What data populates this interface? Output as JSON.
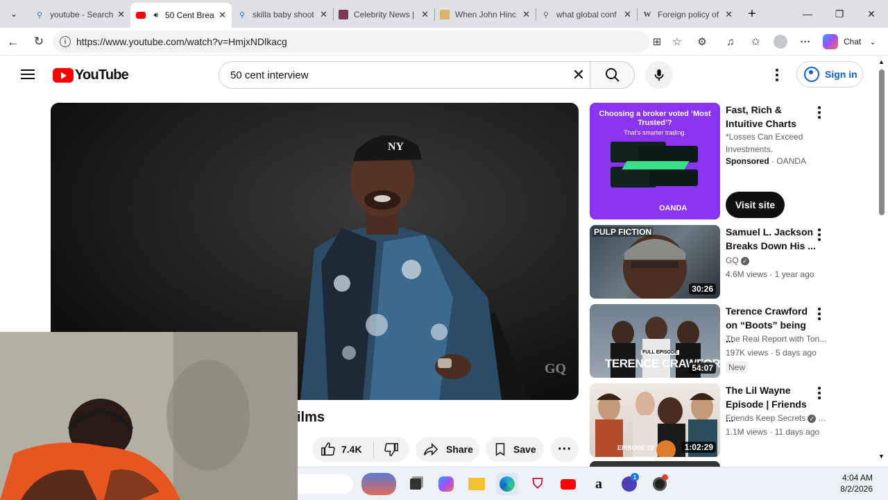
{
  "browser": {
    "tabs": [
      {
        "title": "youtube - Search",
        "icon": "search-icon"
      },
      {
        "title": "50 Cent Brea",
        "icon": "youtube-icon",
        "active": true
      },
      {
        "title": "skilla baby shoot",
        "icon": "search-icon"
      },
      {
        "title": "Celebrity News |",
        "icon": "site-favicon"
      },
      {
        "title": "When John Hinc",
        "icon": "site-favicon"
      },
      {
        "title": "what global conf",
        "icon": "search-icon"
      },
      {
        "title": "Foreign policy of",
        "icon": "wikipedia-icon"
      }
    ],
    "url": "https://www.youtube.com/watch?v=HmjxNDlkacg",
    "chat_label": "Chat"
  },
  "youtube": {
    "logo_text": "YouTube",
    "search_value": "50 cent interview",
    "signin_label": "Sign in"
  },
  "video": {
    "watermark": "GQ",
    "title_fragment": "ilms",
    "like_count": "7.4K",
    "share_label": "Share",
    "save_label": "Save"
  },
  "sidebar": {
    "ad": {
      "headline": "Choosing a broker voted ‘Most Trusted’?",
      "sub": "That’s smarter trading.",
      "brand_mark": "OANDA",
      "title": "Fast, Rich & Intuitive Charts",
      "desc": "*Losses Can Exceed Investments.",
      "sponsored": "Sponsored",
      "advertiser": "OANDA",
      "cta": "Visit site"
    },
    "videos": [
      {
        "thumb_label": "PULP FICTION",
        "title": "Samuel L. Jackson Breaks Down His ...",
        "channel": "GQ",
        "verified": true,
        "views": "4.6M views",
        "age": "1 year ago",
        "duration": "30:26"
      },
      {
        "thumb_label": "TERENCE CRAWFORD",
        "thumb_small": "FULL EPISODE",
        "title": "Terence Crawford on “Boots” being ...",
        "channel": "The Real Report with Ton...",
        "verified": false,
        "views": "197K views",
        "age": "5 days ago",
        "duration": "54:07",
        "badge": "New"
      },
      {
        "thumb_label": "EPISODE 22",
        "title": "The Lil Wayne Episode | Friends ...",
        "channel": "Friends Keep Secrets",
        "verified": true,
        "views": "1.1M views",
        "age": "11 days ago",
        "duration": "1:02:29"
      }
    ]
  },
  "taskbar": {
    "time": "4:04 AM",
    "date": "8/2/2026",
    "notification_count": "1"
  },
  "colors": {
    "yt_red": "#ff0000",
    "link_blue": "#065fd4",
    "ad_purple": "#8a34f2"
  }
}
